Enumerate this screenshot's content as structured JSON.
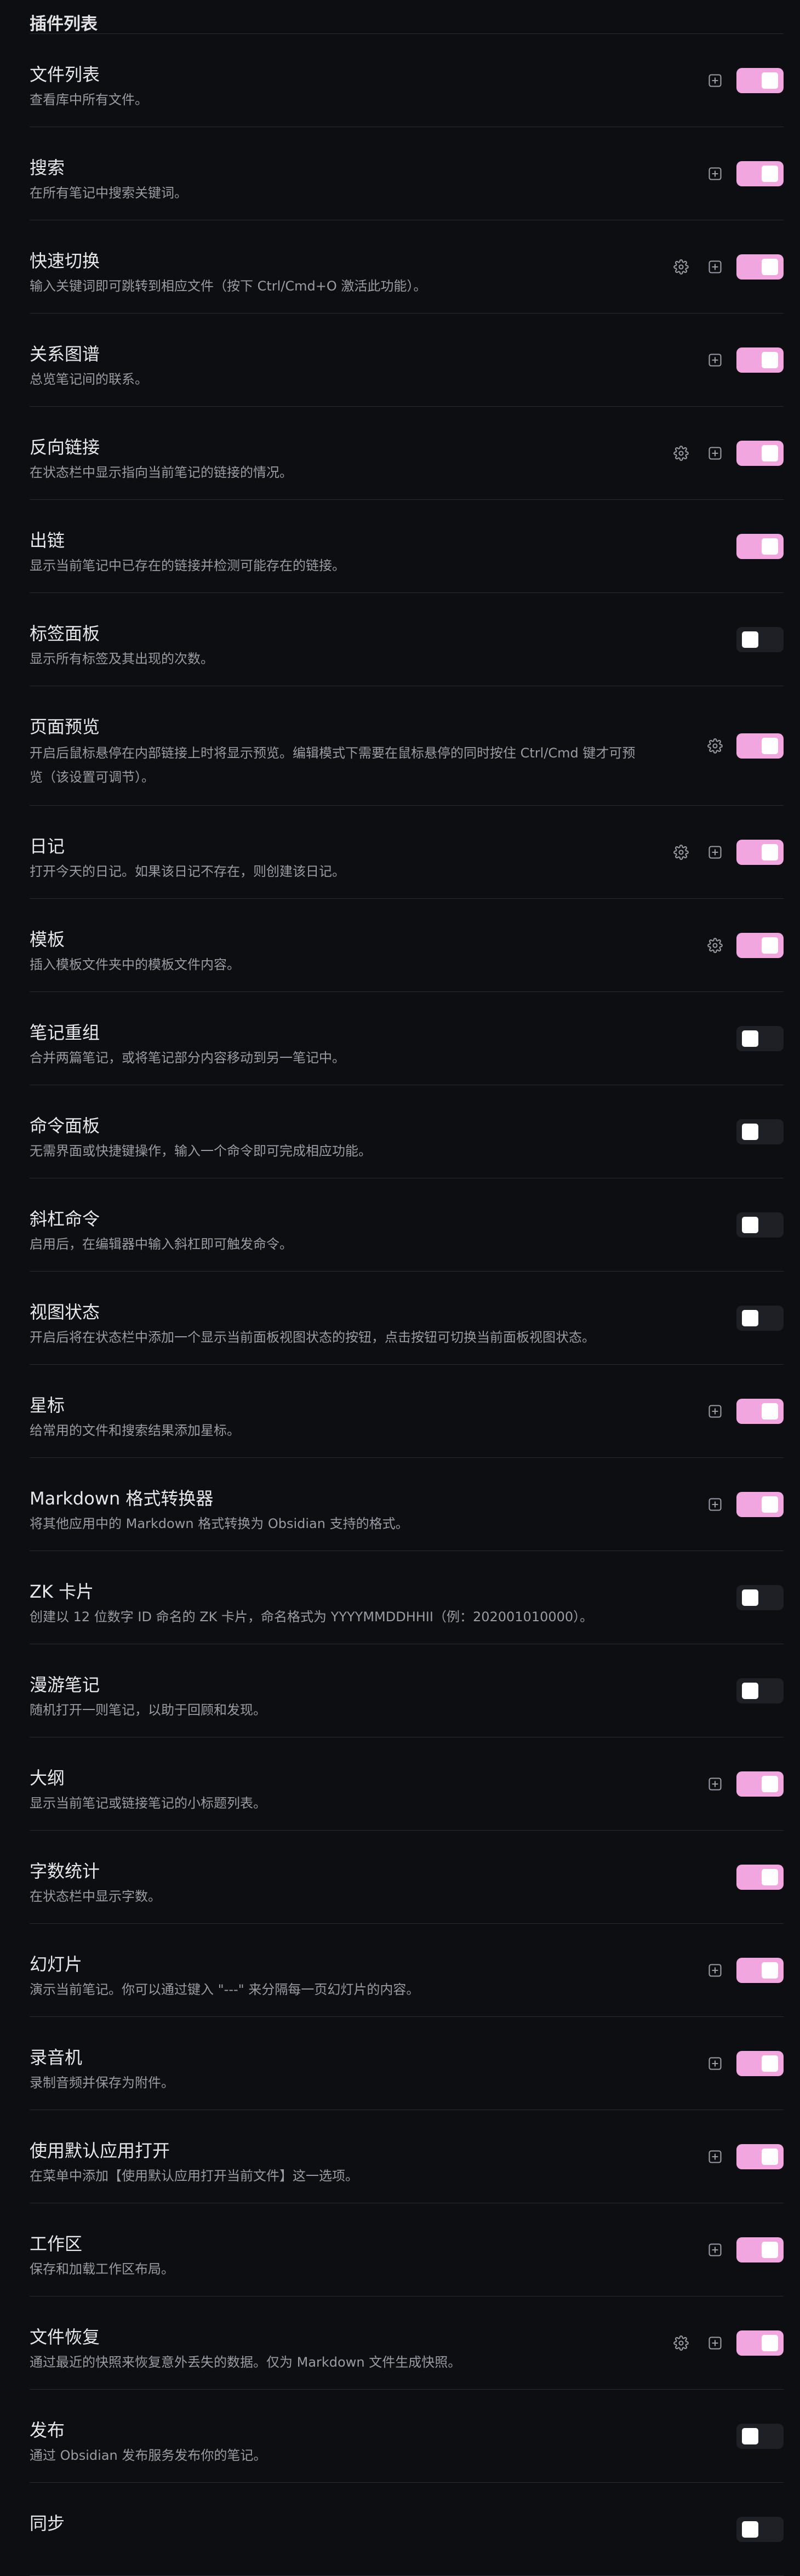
{
  "section_title": "插件列表",
  "colors": {
    "accent": "#f2a6e0",
    "background": "#0d0e11",
    "toggle_off": "#1e2025"
  },
  "plugins": [
    {
      "name": "文件列表",
      "desc": "查看库中所有文件。",
      "enabled": true,
      "settings": false,
      "hotkey": true
    },
    {
      "name": "搜索",
      "desc": "在所有笔记中搜索关键词。",
      "enabled": true,
      "settings": false,
      "hotkey": true
    },
    {
      "name": "快速切换",
      "desc": "输入关键词即可跳转到相应文件（按下 Ctrl/Cmd+O 激活此功能）。",
      "enabled": true,
      "settings": true,
      "hotkey": true
    },
    {
      "name": "关系图谱",
      "desc": "总览笔记间的联系。",
      "enabled": true,
      "settings": false,
      "hotkey": true
    },
    {
      "name": "反向链接",
      "desc": "在状态栏中显示指向当前笔记的链接的情况。",
      "enabled": true,
      "settings": true,
      "hotkey": true
    },
    {
      "name": "出链",
      "desc": "显示当前笔记中已存在的链接并检测可能存在的链接。",
      "enabled": true,
      "settings": false,
      "hotkey": false
    },
    {
      "name": "标签面板",
      "desc": "显示所有标签及其出现的次数。",
      "enabled": false,
      "settings": false,
      "hotkey": false
    },
    {
      "name": "页面预览",
      "desc": "开启后鼠标悬停在内部链接上时将显示预览。编辑模式下需要在鼠标悬停的同时按住 Ctrl/Cmd 键才可预览（该设置可调节）。",
      "enabled": true,
      "settings": true,
      "hotkey": false,
      "tall": true
    },
    {
      "name": "日记",
      "desc": "打开今天的日记。如果该日记不存在，则创建该日记。",
      "enabled": true,
      "settings": true,
      "hotkey": true
    },
    {
      "name": "模板",
      "desc": "插入模板文件夹中的模板文件内容。",
      "enabled": true,
      "settings": true,
      "hotkey": false
    },
    {
      "name": "笔记重组",
      "desc": "合并两篇笔记，或将笔记部分内容移动到另一笔记中。",
      "enabled": false,
      "settings": false,
      "hotkey": false
    },
    {
      "name": "命令面板",
      "desc": "无需界面或快捷键操作，输入一个命令即可完成相应功能。",
      "enabled": false,
      "settings": false,
      "hotkey": false
    },
    {
      "name": "斜杠命令",
      "desc": "启用后，在编辑器中输入斜杠即可触发命令。",
      "enabled": false,
      "settings": false,
      "hotkey": false
    },
    {
      "name": "视图状态",
      "desc": "开启后将在状态栏中添加一个显示当前面板视图状态的按钮，点击按钮可切换当前面板视图状态。",
      "enabled": false,
      "settings": false,
      "hotkey": false
    },
    {
      "name": "星标",
      "desc": "给常用的文件和搜索结果添加星标。",
      "enabled": true,
      "settings": false,
      "hotkey": true
    },
    {
      "name": "Markdown 格式转换器",
      "desc": "将其他应用中的 Markdown 格式转换为 Obsidian 支持的格式。",
      "enabled": true,
      "settings": false,
      "hotkey": true
    },
    {
      "name": "ZK 卡片",
      "desc": "创建以 12 位数字 ID 命名的 ZK 卡片，命名格式为 YYYYMMDDHHII（例：202001010000）。",
      "enabled": false,
      "settings": false,
      "hotkey": false
    },
    {
      "name": "漫游笔记",
      "desc": "随机打开一则笔记，以助于回顾和发现。",
      "enabled": false,
      "settings": false,
      "hotkey": false
    },
    {
      "name": "大纲",
      "desc": "显示当前笔记或链接笔记的小标题列表。",
      "enabled": true,
      "settings": false,
      "hotkey": true
    },
    {
      "name": "字数统计",
      "desc": "在状态栏中显示字数。",
      "enabled": true,
      "settings": false,
      "hotkey": false
    },
    {
      "name": "幻灯片",
      "desc": "演示当前笔记。你可以通过键入 \"---\" 来分隔每一页幻灯片的内容。",
      "enabled": true,
      "settings": false,
      "hotkey": true
    },
    {
      "name": "录音机",
      "desc": "录制音频并保存为附件。",
      "enabled": true,
      "settings": false,
      "hotkey": true
    },
    {
      "name": "使用默认应用打开",
      "desc": "在菜单中添加【使用默认应用打开当前文件】这一选项。",
      "enabled": true,
      "settings": false,
      "hotkey": true
    },
    {
      "name": "工作区",
      "desc": "保存和加载工作区布局。",
      "enabled": true,
      "settings": false,
      "hotkey": true
    },
    {
      "name": "文件恢复",
      "desc": "通过最近的快照来恢复意外丢失的数据。仅为 Markdown 文件生成快照。",
      "enabled": true,
      "settings": true,
      "hotkey": true
    },
    {
      "name": "发布",
      "desc": "通过 Obsidian 发布服务发布你的笔记。",
      "enabled": false,
      "settings": false,
      "hotkey": false
    },
    {
      "name": "同步",
      "desc": "",
      "enabled": false,
      "settings": false,
      "hotkey": false
    }
  ]
}
